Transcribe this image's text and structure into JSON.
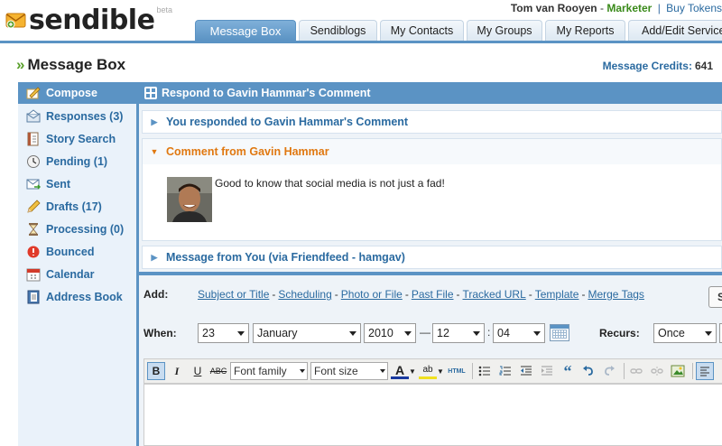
{
  "app": {
    "brand": "sendible",
    "beta": "beta"
  },
  "user": {
    "name": "Tom van Rooyen",
    "dash": "-",
    "role": "Marketer",
    "separator": "|",
    "buy_link": "Buy Tokens"
  },
  "tabs": [
    {
      "label": "Message Box",
      "active": true
    },
    {
      "label": "Sendiblogs"
    },
    {
      "label": "My Contacts"
    },
    {
      "label": "My Groups"
    },
    {
      "label": "My Reports"
    },
    {
      "label": "Add/Edit Services"
    }
  ],
  "page": {
    "title_marker": "»",
    "title": "Message Box",
    "credits_label": "Message Credits:",
    "credits_value": "641"
  },
  "sidebar": {
    "items": [
      {
        "label": "Compose",
        "icon": "compose-icon",
        "active": true
      },
      {
        "label": "Responses (3)",
        "icon": "responses-icon"
      },
      {
        "label": "Story Search",
        "icon": "story-search-icon"
      },
      {
        "label": "Pending (1)",
        "icon": "clock-icon"
      },
      {
        "label": "Sent",
        "icon": "sent-icon"
      },
      {
        "label": "Drafts (17)",
        "icon": "pencil-icon"
      },
      {
        "label": "Processing (0)",
        "icon": "hourglass-icon"
      },
      {
        "label": "Bounced",
        "icon": "bounced-icon"
      },
      {
        "label": "Calendar",
        "icon": "calendar-icon"
      },
      {
        "label": "Address Book",
        "icon": "address-book-icon"
      }
    ]
  },
  "panel": {
    "title": "Respond to Gavin Hammar's Comment",
    "thread": [
      {
        "label": "You responded to Gavin Hammar's Comment",
        "expanded": false
      },
      {
        "label": "Comment from Gavin Hammar",
        "expanded": true
      },
      {
        "label": "Message from You (via Friendfeed - hamgav)",
        "expanded": false
      }
    ],
    "comment_text": "Good to know that social media is not just a fad!"
  },
  "editor": {
    "add_label": "Add:",
    "add_links": [
      "Subject or Title",
      "Scheduling",
      "Photo or File",
      "Past File",
      "Tracked URL",
      "Template",
      "Merge Tags"
    ],
    "link_separator": "-",
    "send_button_partial": "S",
    "when_label": "When:",
    "day": "23",
    "month": "January",
    "year": "2010",
    "range_dash": "—",
    "hour": "12",
    "time_colon": ":",
    "minute": "04",
    "recurs_label": "Recurs:",
    "recurs_value": "Once",
    "font_family_placeholder": "Font family",
    "font_size_placeholder": "Font size",
    "toolbar": {
      "bold": "B",
      "italic": "I",
      "underline": "U",
      "strike": "ABC",
      "text_color": "A",
      "highlight": "ab",
      "html": "HTML",
      "quote": "“"
    }
  },
  "colors": {
    "accent": "#5b93c4",
    "link": "#2a6aa0",
    "role_green": "#3a8a1a",
    "comment_orange": "#e07810",
    "sidebar_bg": "#eaf2fa"
  }
}
